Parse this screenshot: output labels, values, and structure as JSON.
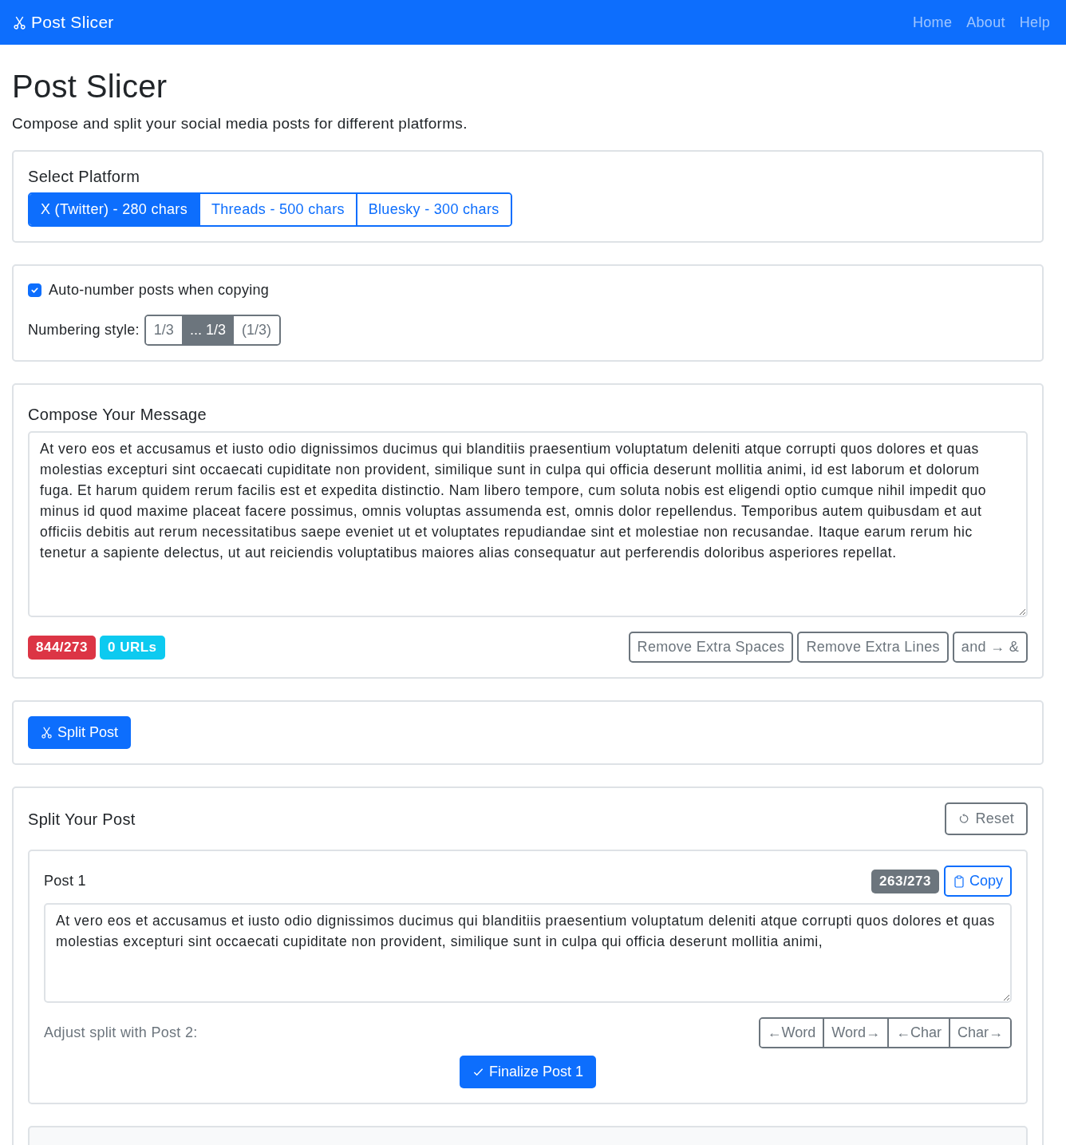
{
  "navbar": {
    "brand": "Post Slicer",
    "links": [
      "Home",
      "About",
      "Help"
    ]
  },
  "page": {
    "title": "Post Slicer",
    "subtitle": "Compose and split your social media posts for different platforms."
  },
  "platform": {
    "title": "Select Platform",
    "options": [
      {
        "label": "X (Twitter) - 280 chars",
        "selected": true
      },
      {
        "label": "Threads - 500 chars",
        "selected": false
      },
      {
        "label": "Bluesky - 300 chars",
        "selected": false
      }
    ]
  },
  "numbering": {
    "auto_number": {
      "label": "Auto-number posts when copying",
      "checked": true
    },
    "style_label": "Numbering style:",
    "styles": [
      {
        "label": "1/3",
        "selected": false
      },
      {
        "label": "... 1/3",
        "selected": true
      },
      {
        "label": "(1/3)",
        "selected": false
      }
    ]
  },
  "compose": {
    "title": "Compose Your Message",
    "text": "At vero eos et accusamus et iusto odio dignissimos ducimus qui blanditiis praesentium voluptatum deleniti atque corrupti quos dolores et quas molestias excepturi sint occaecati cupiditate non provident, similique sunt in culpa qui officia deserunt mollitia animi, id est laborum et dolorum fuga. Et harum quidem rerum facilis est et expedita distinctio. Nam libero tempore, cum soluta nobis est eligendi optio cumque nihil impedit quo minus id quod maxime placeat facere possimus, omnis voluptas assumenda est, omnis dolor repellendus. Temporibus autem quibusdam et aut officiis debitis aut rerum necessitatibus saepe eveniet ut et voluptates repudiandae sint et molestiae non recusandae. Itaque earum rerum hic tenetur a sapiente delectus, ut aut reiciendis voluptatibus maiores alias consequatur aut perferendis doloribus asperiores repellat.",
    "badges": [
      {
        "text": "844/273",
        "kind": "danger"
      },
      {
        "text": "0 URLs",
        "kind": "info"
      }
    ],
    "tools": [
      "Remove Extra Spaces",
      "Remove Extra Lines",
      "and → &"
    ]
  },
  "split_button": "Split Post",
  "split": {
    "title": "Split Your Post",
    "reset": "Reset",
    "posts": [
      {
        "title": "Post 1",
        "count": "263/273",
        "copy": "Copy",
        "text": "At vero eos et accusamus et iusto odio dignissimos ducimus qui blanditiis praesentium voluptatum deleniti atque corrupti quos dolores et quas molestias excepturi sint occaecati cupiditate non provident, similique sunt in culpa qui officia deserunt mollitia animi,",
        "adjust_label": "Adjust split with Post 2:",
        "adjust_buttons": [
          "←Word",
          "Word→",
          "←Char",
          "Char→"
        ],
        "finalize": "Finalize Post 1"
      }
    ]
  }
}
